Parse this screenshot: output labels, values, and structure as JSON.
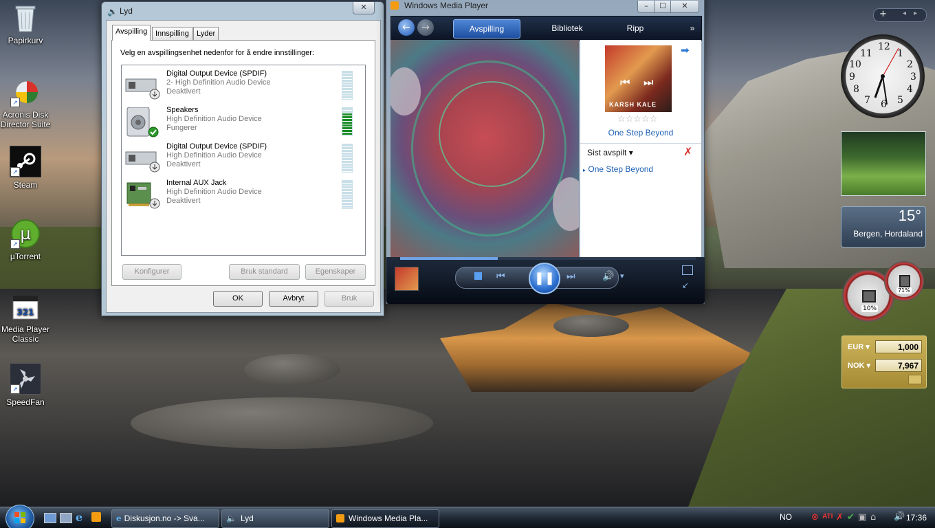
{
  "desktop": {
    "icons": [
      {
        "label": "Papirkurv",
        "icon": "recycle-bin-icon"
      },
      {
        "label": "Acronis Disk Director Suite",
        "icon": "acronis-icon"
      },
      {
        "label": "Steam",
        "icon": "steam-icon"
      },
      {
        "label": "µTorrent",
        "icon": "utorrent-icon"
      },
      {
        "label": "Media Player Classic",
        "icon": "mpc-icon"
      },
      {
        "label": "SpeedFan",
        "icon": "speedfan-icon"
      }
    ]
  },
  "lyd": {
    "title": "Lyd",
    "tabs": [
      "Avspilling",
      "Innspilling",
      "Lyder"
    ],
    "active_tab": "Avspilling",
    "instruction": "Velg en avspillingsenhet nedenfor for å endre innstillinger:",
    "devices": [
      {
        "name": "Digital Output Device (SPDIF)",
        "description": "2- High Definition Audio Device",
        "state": "Deaktivert",
        "level": 0
      },
      {
        "name": "Speakers",
        "description": "High Definition Audio Device",
        "state": "Fungerer",
        "level": 0.8,
        "default": true
      },
      {
        "name": "Digital Output Device (SPDIF)",
        "description": "High Definition Audio Device",
        "state": "Deaktivert",
        "level": 0
      },
      {
        "name": "Internal AUX Jack",
        "description": "High Definition Audio Device",
        "state": "Deaktivert",
        "level": 0
      }
    ],
    "buttons": {
      "configure": "Konfigurer",
      "set_default": "Bruk standard",
      "properties": "Egenskaper",
      "ok": "OK",
      "cancel": "Avbryt",
      "apply": "Bruk"
    }
  },
  "wmp": {
    "title": "Windows Media Player",
    "nav_tabs": [
      "Avspilling",
      "Bibliotek",
      "Ripp"
    ],
    "active_nav": "Avspilling",
    "album_title": "One Step Beyond",
    "album_art_text": "KARSH KALE",
    "rating_stars": 5,
    "rating_value": 0,
    "list_header": "Sist avspilt",
    "list_items": [
      "One Step Beyond"
    ],
    "progress": 0.33
  },
  "gadgets": {
    "clock_time": "17:36",
    "weather": {
      "temp": "15°",
      "location": "Bergen, Hordaland"
    },
    "meters": {
      "cpu": "10%",
      "ram": "71%"
    },
    "currency": [
      {
        "code": "EUR",
        "value": "1,000"
      },
      {
        "code": "NOK",
        "value": "7,967"
      }
    ]
  },
  "taskbar": {
    "buttons": [
      {
        "label": "Diskusjon.no -> Sva...",
        "icon": "ie-icon"
      },
      {
        "label": "Lyd",
        "icon": "speaker-icon"
      },
      {
        "label": "Windows Media Pla...",
        "icon": "wmp-icon"
      }
    ],
    "language": "NO",
    "time": "17:36"
  },
  "colors": {
    "accent": "#1d4ea0",
    "link": "#1e5fb4",
    "meter_green": "#1d8c2a"
  }
}
